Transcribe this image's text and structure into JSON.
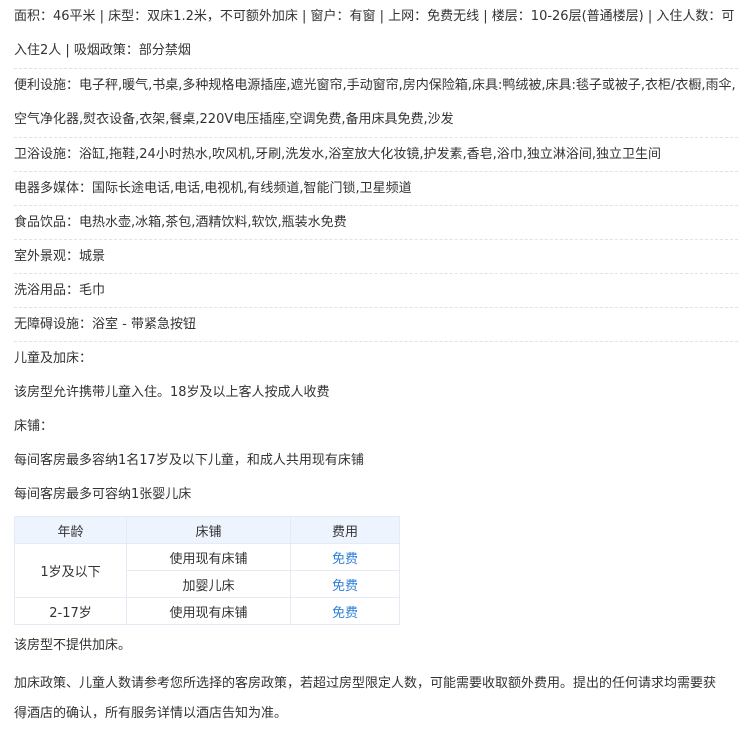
{
  "basic_info": "面积：46平米 | 床型：双床1.2米，不可额外加床 | 窗户：有窗 | 上网：免费无线 | 楼层：10-26层(普通楼层) | 入住人数：可入住2人 | 吸烟政策：部分禁烟",
  "facilities": [
    {
      "key": "便利设施：",
      "value": "电子秤,暖气,书桌,多种规格电源插座,遮光窗帘,手动窗帘,房内保险箱,床具:鸭绒被,床具:毯子或被子,衣柜/衣橱,雨伞,空气净化器,熨衣设备,衣架,餐桌,220V电压插座,空调免费,备用床具免费,沙发"
    },
    {
      "key": "卫浴设施：",
      "value": "浴缸,拖鞋,24小时热水,吹风机,牙刷,洗发水,浴室放大化妆镜,护发素,香皂,浴巾,独立淋浴间,独立卫生间"
    },
    {
      "key": "电器多媒体：",
      "value": "国际长途电话,电话,电视机,有线频道,智能门锁,卫星频道"
    },
    {
      "key": "食品饮品：",
      "value": "电热水壶,冰箱,茶包,酒精饮料,软饮,瓶装水免费"
    },
    {
      "key": "室外景观：",
      "value": "城景"
    },
    {
      "key": "洗浴用品：",
      "value": "毛巾"
    },
    {
      "key": "无障碍设施：",
      "value": "浴室 - 带紧急按钮"
    }
  ],
  "children": {
    "title": "儿童及加床：",
    "allowed": "该房型允许携带儿童入住。18岁及以上客人按成人收费",
    "bed_title": "床铺：",
    "note1": "每间客房最多容纳1名17岁及以下儿童，和成人共用现有床铺",
    "note2": "每间客房最多可容纳1张婴儿床"
  },
  "bed_table": {
    "headers": [
      "年龄",
      "床铺",
      "费用"
    ],
    "group1_age": "1岁及以下",
    "rows": [
      {
        "bed": "使用现有床铺",
        "fee": "免费"
      },
      {
        "bed": "加婴儿床",
        "fee": "免费"
      }
    ],
    "group2_age": "2-17岁",
    "group2": {
      "bed": "使用现有床铺",
      "fee": "免费"
    }
  },
  "extra_bed": "该房型不提供加床。",
  "policy": "加床政策、儿童人数请参考您所选择的客房政策，若超过房型限定人数，可能需要收取额外费用。提出的任何请求均需要获得酒店的确认，所有服务详情以酒店告知为准。"
}
